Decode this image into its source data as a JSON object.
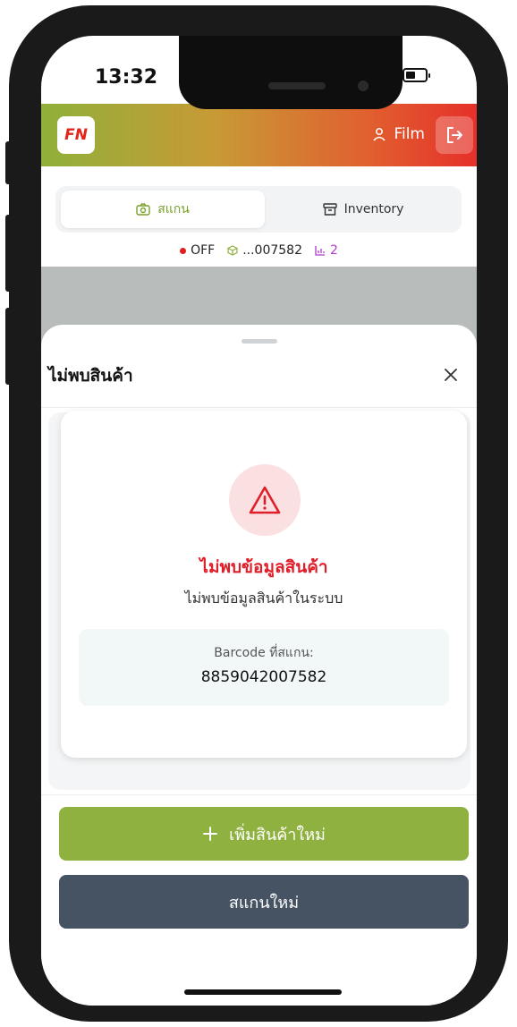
{
  "status_bar": {
    "time": "13:32"
  },
  "app": {
    "logo_text": "FN",
    "user_name": "Film"
  },
  "tabs": [
    {
      "label": "สแกน",
      "active": true
    },
    {
      "label": "Inventory",
      "active": false
    }
  ],
  "scanner_status": {
    "connection": "OFF",
    "device": "...007582",
    "count": "2"
  },
  "sheet": {
    "title": "ไม่พบสินค้า",
    "error_title": "ไม่พบข้อมูลสินค้า",
    "error_message": "ไม่พบข้อมูลสินค้าในระบบ",
    "barcode_label": "Barcode ที่สแกน:",
    "barcode_value": "8859042007582"
  },
  "actions": {
    "add_product": "เพิ่มสินค้าใหม่",
    "rescan": "สแกนใหม่"
  },
  "colors": {
    "brand_green": "#8fb13f",
    "brand_red": "#e6302a",
    "error_red": "#e01e2a",
    "dark_button": "#455362",
    "purple": "#b03ad0"
  }
}
